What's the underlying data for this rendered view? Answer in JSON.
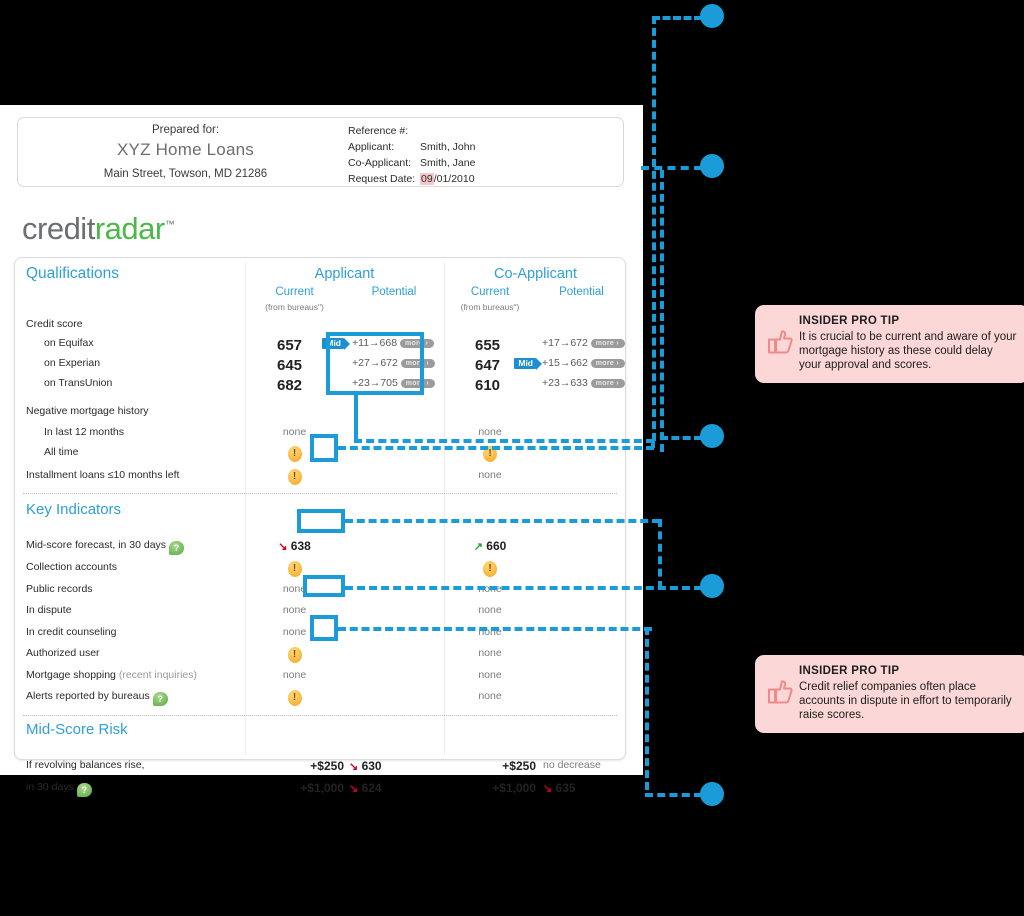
{
  "header_card": {
    "prepared_for_label": "Prepared for:",
    "company": "XYZ Home Loans",
    "address": "Main Street, Towson, MD 21286",
    "reference_label": "Reference #:",
    "reference_value": "",
    "applicant_label": "Applicant:",
    "applicant_value": "Smith, John",
    "coapplicant_label": "Co-Applicant:",
    "coapplicant_value": "Smith, Jane",
    "request_date_label": "Request Date:",
    "request_date_highlight": "09",
    "request_date_rest": "/01/2010"
  },
  "logo": {
    "part1": "credit",
    "part2": "radar",
    "tm": "™"
  },
  "columns": {
    "applicant": "Applicant",
    "coapplicant": "Co-Applicant",
    "current": "Current",
    "potential": "Potential",
    "from_bureaus": "(from bureausʺ)"
  },
  "sections": {
    "qualifications": "Qualifications",
    "key_indicators": "Key Indicators",
    "mid_score_risk": "Mid-Score Risk"
  },
  "qualifications": {
    "credit_score_label": "Credit score",
    "bureaus": [
      {
        "label": "on Equifax",
        "app_mid": "Mid",
        "app_current": "657",
        "app_delta": "+11",
        "app_arrow": "→",
        "app_potential": "668",
        "app_more": "more ›",
        "co_mid": "",
        "co_current": "655",
        "co_delta": "+17",
        "co_arrow": "→",
        "co_potential": "672",
        "co_more": "more ›"
      },
      {
        "label": "on Experian",
        "app_mid": "",
        "app_current": "645",
        "app_delta": "+27",
        "app_arrow": "→",
        "app_potential": "672",
        "app_more": "more ›",
        "co_mid": "Mid",
        "co_current": "647",
        "co_delta": "+15",
        "co_arrow": "→",
        "co_potential": "662",
        "co_more": "more ›"
      },
      {
        "label": "on TransUnion",
        "app_mid": "",
        "app_current": "682",
        "app_delta": "+23",
        "app_arrow": "→",
        "app_potential": "705",
        "app_more": "more ›",
        "co_mid": "",
        "co_current": "610",
        "co_delta": "+23",
        "co_arrow": "→",
        "co_potential": "633",
        "co_more": "more ›"
      }
    ],
    "negative_mortgage_label": "Negative mortgage history",
    "neg_rows": [
      {
        "label": "In last 12 months",
        "app": "none",
        "co": "none",
        "app_type": "text",
        "co_type": "text"
      },
      {
        "label": "All time",
        "app": "!",
        "co": "!",
        "app_type": "warn",
        "co_type": "warn"
      }
    ],
    "installment_label": "Installment loans ≤10 months left",
    "installment_app": "!",
    "installment_co": "none"
  },
  "key_indicators": [
    {
      "label": "Mid-score forecast, in 30 days",
      "help": true,
      "app": "638",
      "app_type": "down",
      "co": "660",
      "co_type": "up"
    },
    {
      "label": "Collection accounts",
      "help": false,
      "app": "!",
      "app_type": "warn",
      "co": "!",
      "co_type": "warn"
    },
    {
      "label": "Public records",
      "help": false,
      "app": "none",
      "app_type": "text",
      "co": "none",
      "co_type": "text"
    },
    {
      "label": "In dispute",
      "help": false,
      "app": "none",
      "app_type": "text",
      "co": "none",
      "co_type": "text"
    },
    {
      "label": "In credit counseling",
      "help": false,
      "app": "none",
      "app_type": "text",
      "co": "none",
      "co_type": "text"
    },
    {
      "label": "Authorized user",
      "help": false,
      "app": "!",
      "app_type": "warn",
      "co": "none",
      "co_type": "text"
    },
    {
      "label": "Mortgage shopping",
      "label_muted": " (recent inquiries)",
      "help": false,
      "app": "none",
      "app_type": "text",
      "co": "none",
      "co_type": "text"
    },
    {
      "label": "Alerts reported by bureaus",
      "help": true,
      "app": "!",
      "app_type": "warn",
      "co": "none",
      "co_type": "text"
    }
  ],
  "mid_score_risk": {
    "line1": "If revolving balances rise,",
    "line2": "in 30 days",
    "help": true,
    "rows": [
      {
        "app_amount": "+$250",
        "app_score": "630",
        "app_type": "down",
        "co_amount": "+$250",
        "co_score": "no decrease",
        "co_type": "text"
      },
      {
        "app_amount": "+$1,000",
        "app_score": "624",
        "app_type": "down",
        "co_amount": "+$1,000",
        "co_score": "635",
        "co_type": "down"
      }
    ]
  },
  "tips": [
    {
      "title": "INSIDER PRO TIP",
      "body": "It is crucial to be current and aware of your mortgage history as these could delay your approval and scores."
    },
    {
      "title": "INSIDER PRO TIP",
      "body": "Credit relief companies often place accounts in dispute in effort to temporarily raise scores."
    }
  ],
  "icons": {
    "warning": "!",
    "help": "?",
    "thumb": "thumbs-up-icon",
    "arrow_right": "→",
    "arrow_down": "↘",
    "arrow_up": "↗"
  },
  "colors": {
    "accent_blue": "#1b9bd8",
    "heading_blue": "#2e9fd8",
    "warn_orange": "#f5a623",
    "help_green": "#5aa843",
    "down_red": "#cc0022",
    "up_green": "#2f9e44",
    "tip_pink": "#fbd7d7",
    "logo_gray": "#6d6e70",
    "logo_green": "#4cb849"
  }
}
